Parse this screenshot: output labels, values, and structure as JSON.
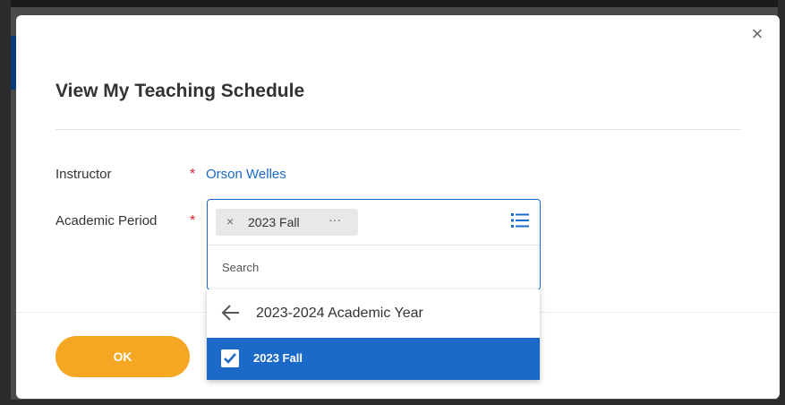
{
  "dialog": {
    "close_label": "×",
    "title": "View My Teaching Schedule",
    "fields": {
      "instructor": {
        "label": "Instructor",
        "required_mark": "*",
        "value": "Orson Welles"
      },
      "academic_period": {
        "label": "Academic Period",
        "required_mark": "*",
        "pill": {
          "remove": "×",
          "label": "2023 Fall",
          "more": "···"
        },
        "list_icon": "list-icon",
        "search": {
          "placeholder": "Search",
          "value": ""
        }
      }
    },
    "ok_label": "OK"
  },
  "dropdown": {
    "back_icon": "arrow-left-icon",
    "back_label": "2023-2024 Academic Year",
    "selected_item": {
      "label": "2023 Fall",
      "checked": true
    }
  },
  "colors": {
    "accent": "#1b6ac9",
    "required": "#d9232d",
    "primary_button": "#f5a623",
    "selected_row": "#1b6ac9"
  }
}
